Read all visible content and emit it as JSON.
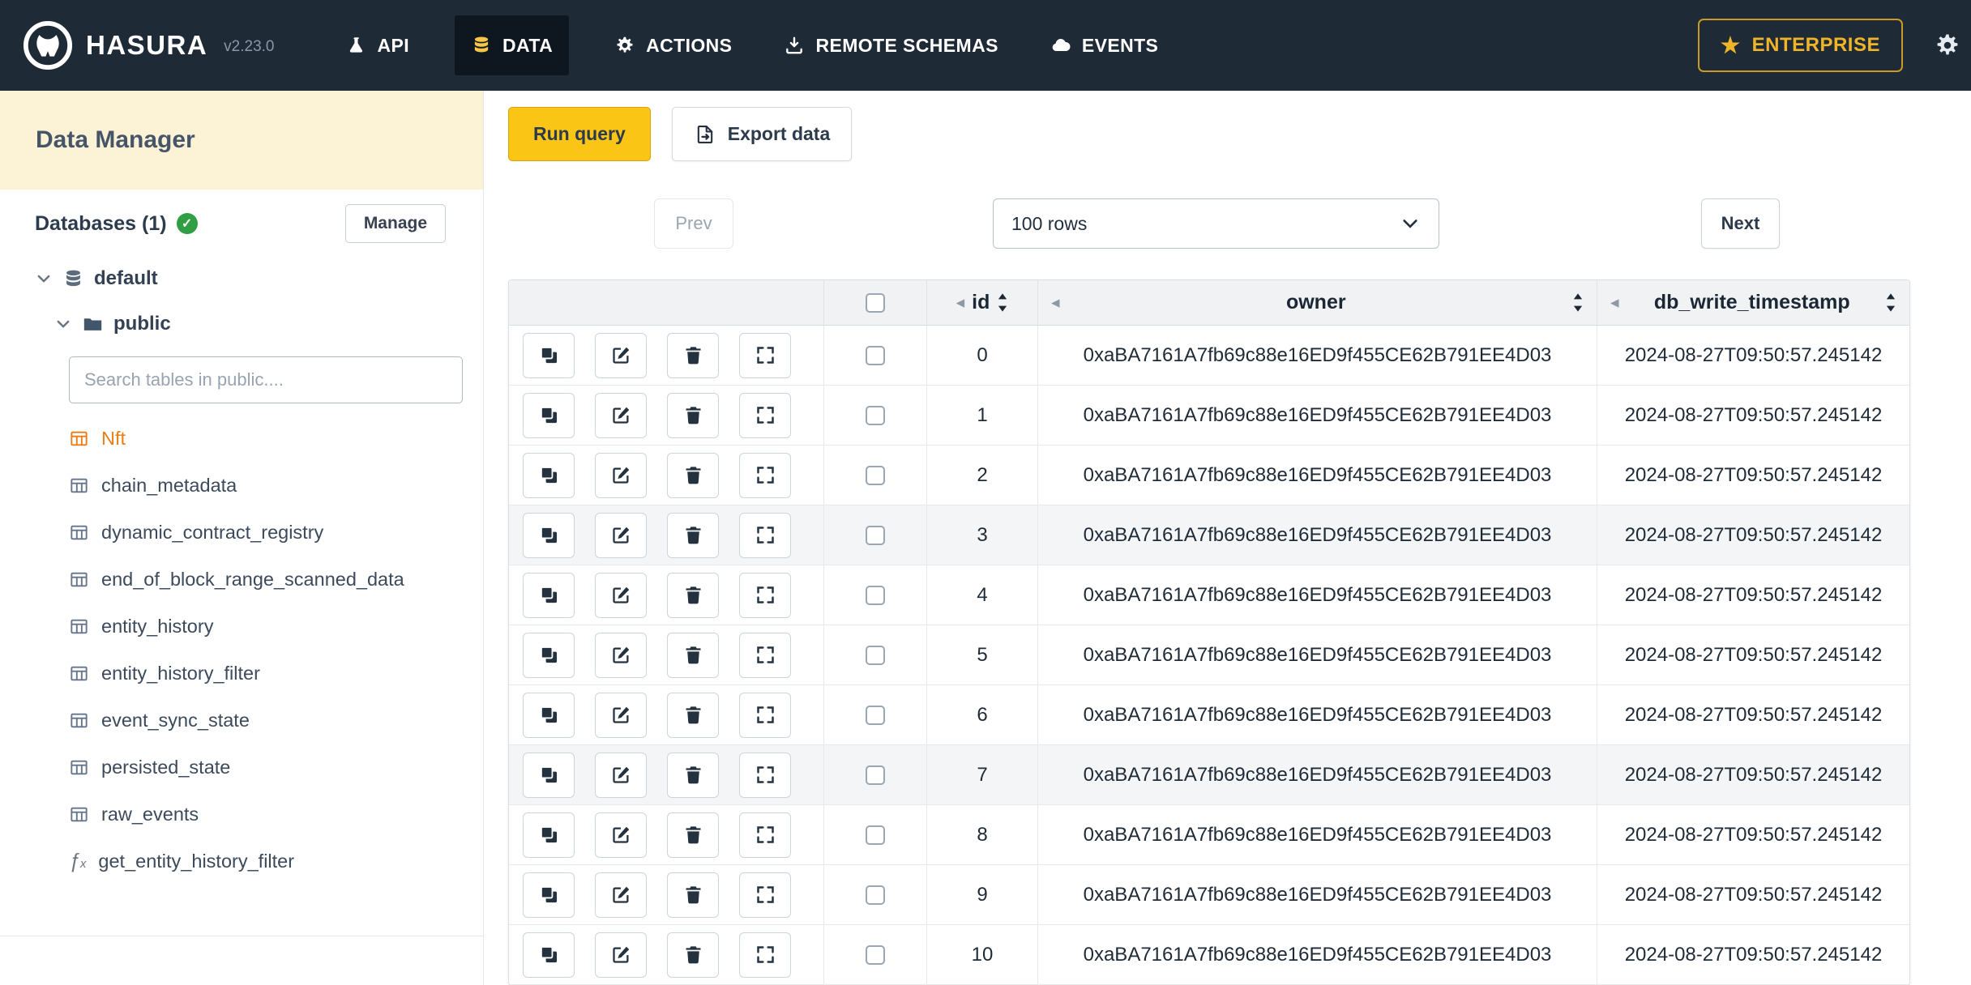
{
  "navbar": {
    "brand": "HASURA",
    "version": "v2.23.0",
    "items": [
      {
        "label": "API",
        "icon": "flask-icon"
      },
      {
        "label": "DATA",
        "icon": "database-icon"
      },
      {
        "label": "ACTIONS",
        "icon": "gear-icon"
      },
      {
        "label": "REMOTE SCHEMAS",
        "icon": "download-icon"
      },
      {
        "label": "EVENTS",
        "icon": "cloud-icon"
      }
    ],
    "enterprise_label": "ENTERPRISE"
  },
  "sidebar": {
    "title": "Data Manager",
    "databases_label": "Databases (1)",
    "manage_button": "Manage",
    "tree": {
      "database": "default",
      "schema": "public"
    },
    "search_placeholder": "Search tables in public....",
    "tables": [
      {
        "name": "Nft",
        "highlighted": true
      },
      {
        "name": "chain_metadata"
      },
      {
        "name": "dynamic_contract_registry"
      },
      {
        "name": "end_of_block_range_scanned_data"
      },
      {
        "name": "entity_history"
      },
      {
        "name": "entity_history_filter"
      },
      {
        "name": "event_sync_state"
      },
      {
        "name": "persisted_state"
      },
      {
        "name": "raw_events"
      },
      {
        "name": "get_entity_history_filter",
        "type": "function"
      }
    ]
  },
  "toolbar": {
    "run_query": "Run query",
    "export_data": "Export data"
  },
  "pagination": {
    "prev": "Prev",
    "rows_label": "100 rows",
    "next": "Next"
  },
  "table": {
    "columns": [
      {
        "label": "id"
      },
      {
        "label": "owner"
      },
      {
        "label": "db_write_timestamp"
      }
    ],
    "row_actions": [
      {
        "name": "clone-row",
        "icon": "copy"
      },
      {
        "name": "edit-row",
        "icon": "edit"
      },
      {
        "name": "delete-row",
        "icon": "trash"
      },
      {
        "name": "expand-row",
        "icon": "expand"
      }
    ],
    "rows": [
      {
        "id": "0",
        "owner": "0xaBA7161A7fb69c88e16ED9f455CE62B791EE4D03",
        "db_write_timestamp": "2024-08-27T09:50:57.245142"
      },
      {
        "id": "1",
        "owner": "0xaBA7161A7fb69c88e16ED9f455CE62B791EE4D03",
        "db_write_timestamp": "2024-08-27T09:50:57.245142"
      },
      {
        "id": "2",
        "owner": "0xaBA7161A7fb69c88e16ED9f455CE62B791EE4D03",
        "db_write_timestamp": "2024-08-27T09:50:57.245142"
      },
      {
        "id": "3",
        "owner": "0xaBA7161A7fb69c88e16ED9f455CE62B791EE4D03",
        "db_write_timestamp": "2024-08-27T09:50:57.245142"
      },
      {
        "id": "4",
        "owner": "0xaBA7161A7fb69c88e16ED9f455CE62B791EE4D03",
        "db_write_timestamp": "2024-08-27T09:50:57.245142"
      },
      {
        "id": "5",
        "owner": "0xaBA7161A7fb69c88e16ED9f455CE62B791EE4D03",
        "db_write_timestamp": "2024-08-27T09:50:57.245142"
      },
      {
        "id": "6",
        "owner": "0xaBA7161A7fb69c88e16ED9f455CE62B791EE4D03",
        "db_write_timestamp": "2024-08-27T09:50:57.245142"
      },
      {
        "id": "7",
        "owner": "0xaBA7161A7fb69c88e16ED9f455CE62B791EE4D03",
        "db_write_timestamp": "2024-08-27T09:50:57.245142"
      },
      {
        "id": "8",
        "owner": "0xaBA7161A7fb69c88e16ED9f455CE62B791EE4D03",
        "db_write_timestamp": "2024-08-27T09:50:57.245142"
      },
      {
        "id": "9",
        "owner": "0xaBA7161A7fb69c88e16ED9f455CE62B791EE4D03",
        "db_write_timestamp": "2024-08-27T09:50:57.245142"
      },
      {
        "id": "10",
        "owner": "0xaBA7161A7fb69c88e16ED9f455CE62B791EE4D03",
        "db_write_timestamp": "2024-08-27T09:50:57.245142"
      }
    ]
  },
  "colors": {
    "navbar_bg": "#1f2a37",
    "accent_yellow": "#fac515",
    "enterprise_gold": "#f0b429",
    "highlight_orange": "#e97d16",
    "verified_green": "#2f9e44",
    "sidebar_title_bg": "#fcf3d6"
  }
}
